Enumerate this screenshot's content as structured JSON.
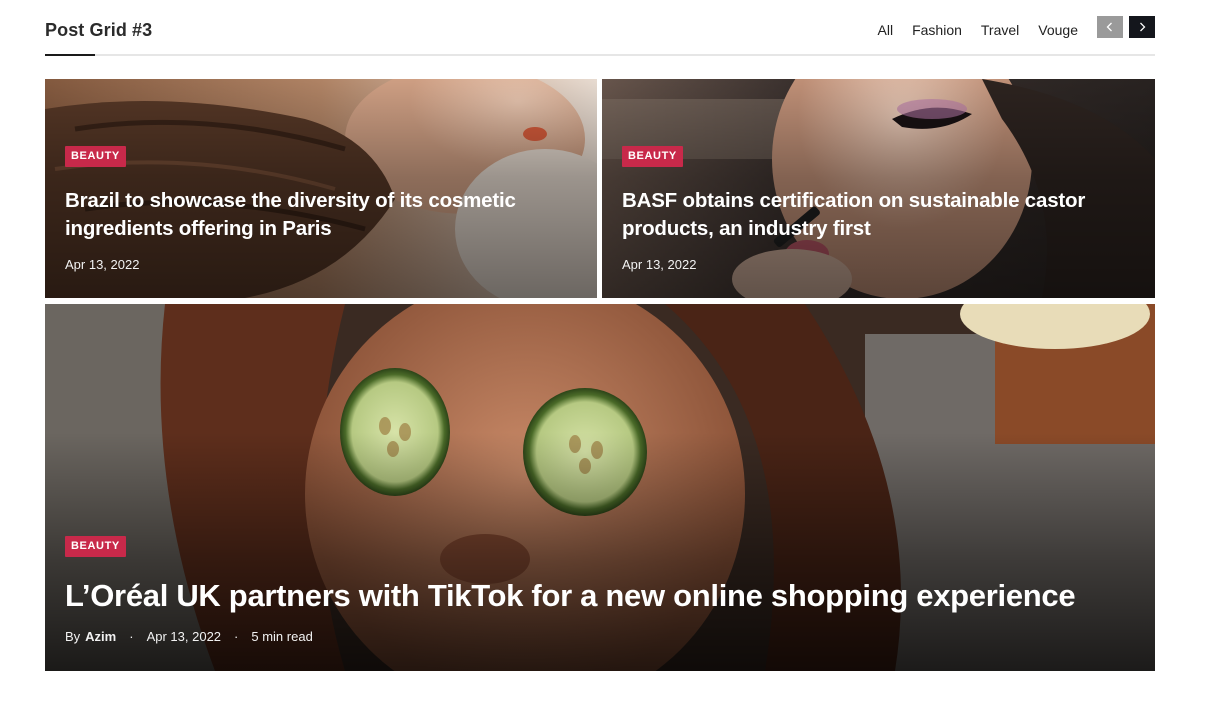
{
  "section": {
    "title": "Post Grid #3",
    "filters": [
      "All",
      "Fashion",
      "Travel",
      "Vouge"
    ]
  },
  "colors": {
    "badge": "#c8294a",
    "nav_prev": "#9a9a9a",
    "nav_next": "#14161c"
  },
  "posts": [
    {
      "category": "BEAUTY",
      "title": "Brazil to showcase the diversity of its cosmetic ingredients offering in Paris",
      "date": "Apr 13, 2022"
    },
    {
      "category": "BEAUTY",
      "title": "BASF obtains certification on sustainable castor products, an industry first",
      "date": "Apr 13, 2022"
    },
    {
      "category": "BEAUTY",
      "title": "L’Oréal UK partners with TikTok for a new online shopping experience",
      "by_label": "By",
      "author": "Azim",
      "date": "Apr 13, 2022",
      "read_time": "5 min read",
      "separator": "·"
    }
  ]
}
